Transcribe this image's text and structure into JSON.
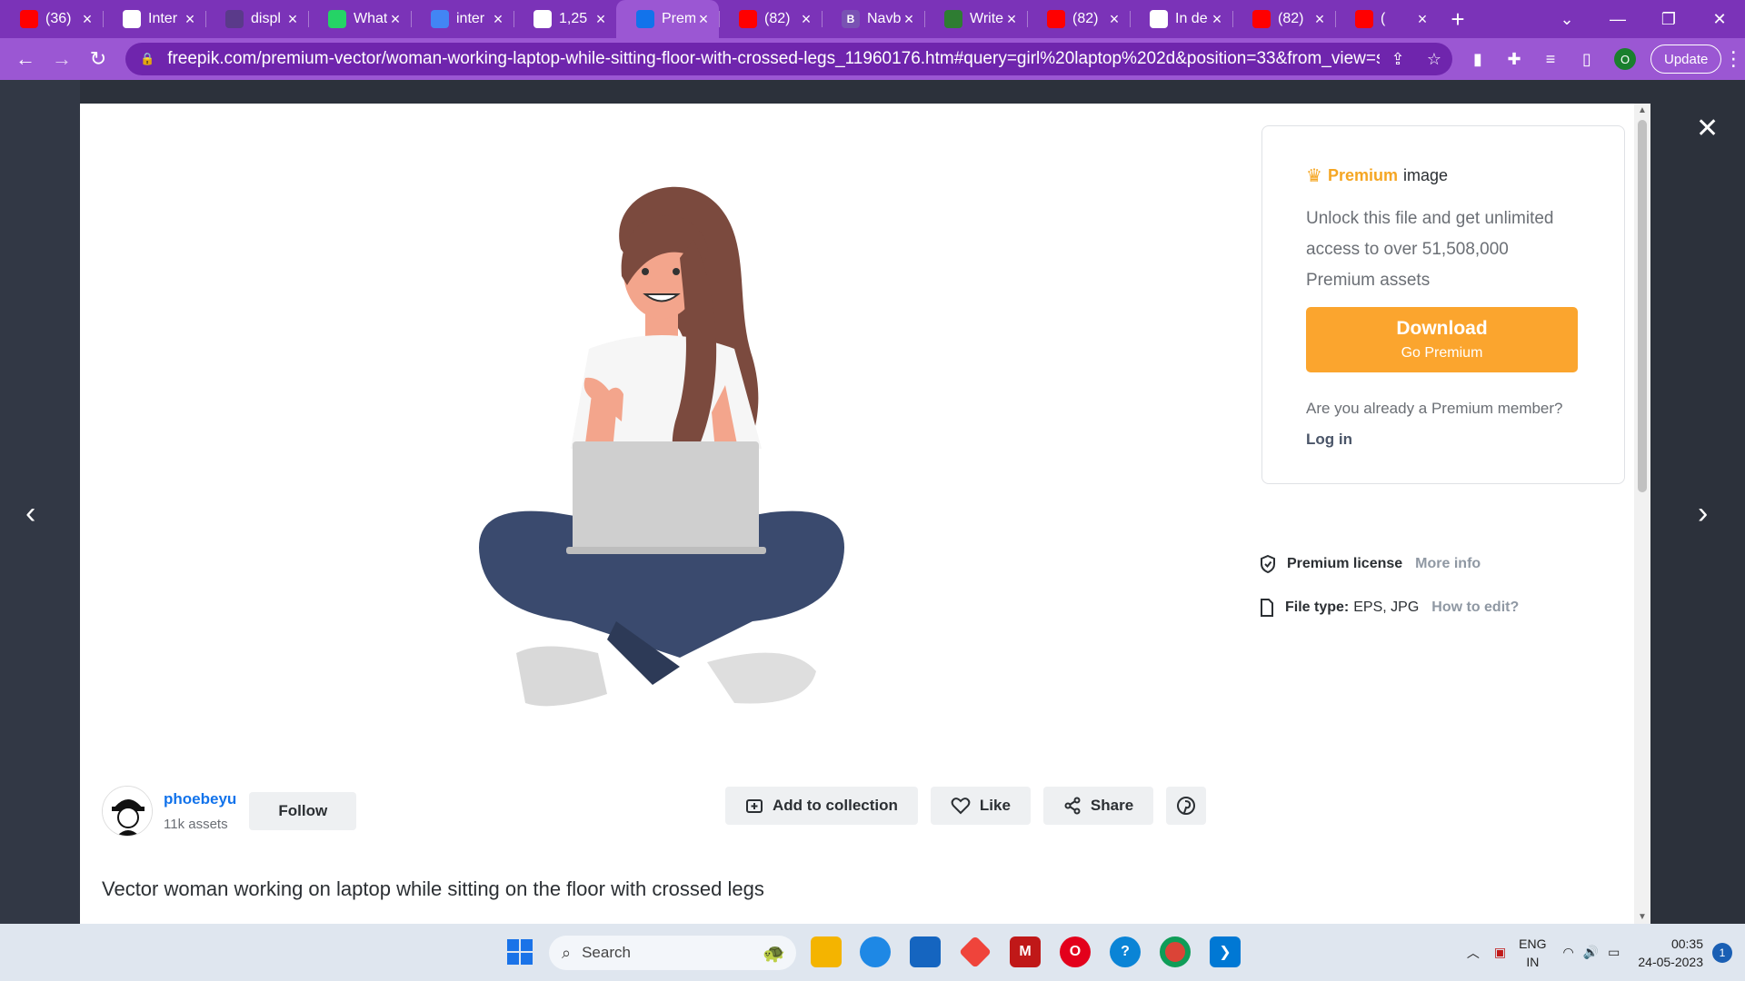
{
  "browser": {
    "tabs": [
      {
        "title": "(36)",
        "icon": "youtube-icon",
        "color": "#ff0000"
      },
      {
        "title": "Inter",
        "icon": "globe-icon",
        "color": "#ffffff"
      },
      {
        "title": "displ",
        "icon": "site-icon",
        "color": "#5a3a8a"
      },
      {
        "title": "What",
        "icon": "whatsapp-icon",
        "color": "#25d366"
      },
      {
        "title": "inter",
        "icon": "docs-icon",
        "color": "#4285f4"
      },
      {
        "title": "1,25",
        "icon": "info-icon",
        "color": "#ffffff"
      },
      {
        "title": "Prem",
        "icon": "freepik-icon",
        "color": "#1273eb",
        "active": true
      },
      {
        "title": "(82)",
        "icon": "youtube-icon",
        "color": "#ff0000"
      },
      {
        "title": "Navb",
        "icon": "bootstrap-icon",
        "color": "#7952b3",
        "letter": "B"
      },
      {
        "title": "Write",
        "icon": "site-icon",
        "color": "#2e7d32"
      },
      {
        "title": "(82)",
        "icon": "youtube-icon",
        "color": "#ff0000"
      },
      {
        "title": "In de",
        "icon": "globe-icon",
        "color": "#ffffff"
      },
      {
        "title": "(82)",
        "icon": "youtube-icon",
        "color": "#ff0000"
      },
      {
        "title": "(",
        "icon": "youtube-icon",
        "color": "#ff0000"
      }
    ],
    "url": "freepik.com/premium-vector/woman-working-laptop-while-sitting-floor-with-crossed-legs_11960176.htm#query=girl%20laptop%202d&position=33&from_view=search&...",
    "profile_letter": "O",
    "update_label": "Update"
  },
  "page": {
    "author": {
      "name": "phoebeyu",
      "assets": "11k assets",
      "follow_label": "Follow"
    },
    "actions": {
      "add_collection": "Add to collection",
      "like": "Like",
      "share": "Share"
    },
    "image_title": "Vector woman working on laptop while sitting on the floor with crossed legs",
    "premium": {
      "badge_word": "Premium",
      "badge_rest": "image",
      "description": "Unlock this file and get unlimited access to over 51,508,000 Premium assets",
      "download_title": "Download",
      "download_sub": "Go Premium",
      "member_question": "Are you already a Premium member?",
      "login": "Log in"
    },
    "license": {
      "label": "Premium license",
      "more_info": "More info"
    },
    "filetype": {
      "label": "File type:",
      "value": "EPS, JPG",
      "how_to": "How to edit?"
    }
  },
  "taskbar": {
    "search_placeholder": "Search",
    "lang_top": "ENG",
    "lang_bottom": "IN",
    "time": "00:35",
    "date": "24-05-2023",
    "notifications": "1"
  },
  "colors": {
    "tabstrip": "#7b33b8",
    "toolbar": "#9b57d3",
    "premium_accent": "#f5a623",
    "download_button": "#fba52e",
    "author_link": "#1273eb"
  }
}
